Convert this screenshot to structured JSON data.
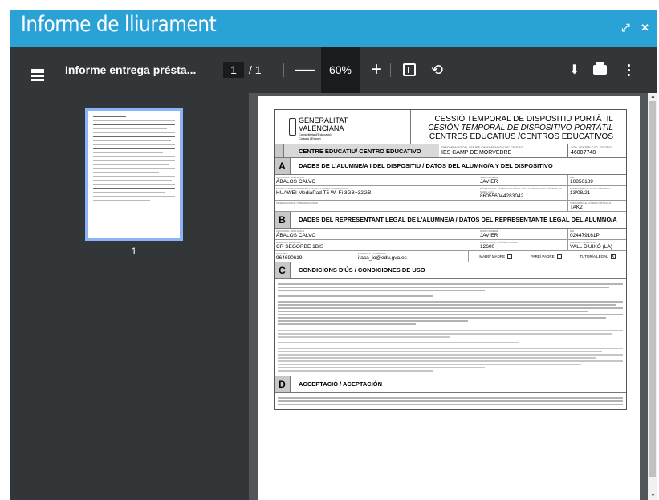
{
  "header": {
    "title": "Informe de lliurament",
    "expand_icon": "expand-icon",
    "close_icon": "close-icon"
  },
  "toolbar": {
    "doc_title": "Informe entrega présta...",
    "current_page": "1",
    "total_pages": "/ 1",
    "zoom": "60%",
    "zoom_out": "—",
    "zoom_in": "+"
  },
  "thumbnail": {
    "page_number": "1"
  },
  "document": {
    "logo_line1": "GENERALITAT",
    "logo_line2": "VALENCIANA",
    "logo_sub1": "Conselleria d'Educació,",
    "logo_sub2": "Cultura i Esport",
    "title1": "CESSIÓ TEMPORAL DE DISPOSITIU PORTÀTIL",
    "title2": "CESIÓN TEMPORAL DE DISPOSITIVO PORTÁTIL",
    "title3": "CENTRES EDUCATIUS /CENTROS EDUCATIVOS",
    "school_label": "CENTRE EDUCATIU/ CENTRO EDUCATIVO",
    "school_name_cap": "DENOMINACIÓ DEL CENTRE /DENOMINACIÓN DEL CENTRO",
    "school_name": "IES CAMP DE MORVEDRE",
    "school_code_cap": "COD. CENTRE/ COD. CENTRO",
    "school_code": "46007748",
    "secA_letter": "A",
    "secA_title": "DADES DE L'ALUMNE/A I DEL DISPOSITIU / DATOS DEL ALUMNO/A Y DEL DISPOSITIVO",
    "surname_cap": "COGNOMS / APELLIDOS",
    "student_surname": "ÁBALOS CALVO",
    "name_cap": "NOM / NOMBRE",
    "student_name": "JAVIER",
    "nia_cap": "NIA",
    "student_nia": "10850189",
    "device_cap": "MARCA I MODEL DISPOSITIU/ MARCA Y MODELO DISPOSITIVO",
    "device": "HUAWEI MediaPad T5 Wi-Fi 3GB+32GB",
    "serial_cap": "NÚM TAULETA, NÚMERO DE SÈRIE o ICC / NÚM TABLETA, NÚMERO DE SERIE o ICC",
    "serial": "860556044283042",
    "date_cap": "DATA ENTREGA / FECHA ENTREGA",
    "date": "13/08/21",
    "obs_cap": "OBSERVACIONS / OBSERVACIONES",
    "code_cap": "CODI ARTICLE / CÓDIGO ARTÍCULO",
    "code": "TAK2",
    "secB_letter": "B",
    "secB_title": "DADES DEL REPRESENTANT LEGAL DE L'ALUMNE/A / DATOS DEL REPRESENTANTE LEGAL DEL ALUMNO/A",
    "rep_surname": "ÁBALOS CALVO",
    "rep_name": "JAVIER",
    "dni_cap": "DNI",
    "rep_dni": "024479161P",
    "address_cap": "DOMICILI / DOMICILIO",
    "address": "CR SEGORBE 1BIS",
    "cp_cap": "CODI POSTAL / CÓDIGO POSTAL",
    "cp": "12600",
    "town_cap": "MUNICIPI / MUNICIPIO",
    "town": "VALL D'UIXÓ (LA)",
    "phone_cap": "NÚM. TEL.",
    "phone": "964690619",
    "email_cap": "CORREU E. / CORREO E.",
    "email": "itaca_io@edu.gva.es",
    "mother": "MARE/ MADRE",
    "father": "PARE/ PADRE",
    "tutor": "TUTOR/A LEGAL",
    "tutor_mark": "X",
    "secC_letter": "C",
    "secC_title": "CONDICIONS D'ÚS / CONDICIONES DE USO",
    "secD_letter": "D",
    "secD_title": "ACCEPTACIÓ / ACEPTACIÓN"
  }
}
